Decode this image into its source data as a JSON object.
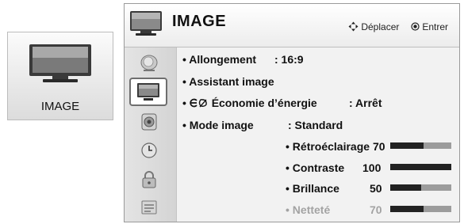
{
  "tile": {
    "label": "IMAGE",
    "icon": "tv-icon"
  },
  "header": {
    "title": "IMAGE",
    "move_hint": "Déplacer",
    "enter_hint": "Entrer"
  },
  "sidebar": {
    "items": [
      {
        "icon": "satellite-dish-icon",
        "selected": false
      },
      {
        "icon": "tv-icon",
        "selected": true
      },
      {
        "icon": "speaker-icon",
        "selected": false
      },
      {
        "icon": "clock-icon",
        "selected": false
      },
      {
        "icon": "lock-icon",
        "selected": false
      },
      {
        "icon": "options-icon",
        "selected": false
      }
    ]
  },
  "menu": {
    "aspect": {
      "label": "• Allongement",
      "value": ": 16:9"
    },
    "wizard": {
      "label": "• Assistant image"
    },
    "energy": {
      "label": "Économie d’énergie",
      "value": ": Arrêt"
    },
    "mode": {
      "label": "• Mode image",
      "value": ": Standard"
    },
    "settings": [
      {
        "label": "• Rétroéclairage",
        "value": "70",
        "fraction": 0.55
      },
      {
        "label": "• Contraste",
        "value": "100",
        "fraction": 1.0
      },
      {
        "label": "• Brillance",
        "value": "50",
        "fraction": 0.5
      },
      {
        "label": "• Netteté",
        "value": "70",
        "fraction": 0.55
      }
    ]
  },
  "colors": {
    "bar_fill": "#222222",
    "bar_track": "#9c9c9c",
    "selected_border": "#6e6e6e"
  }
}
